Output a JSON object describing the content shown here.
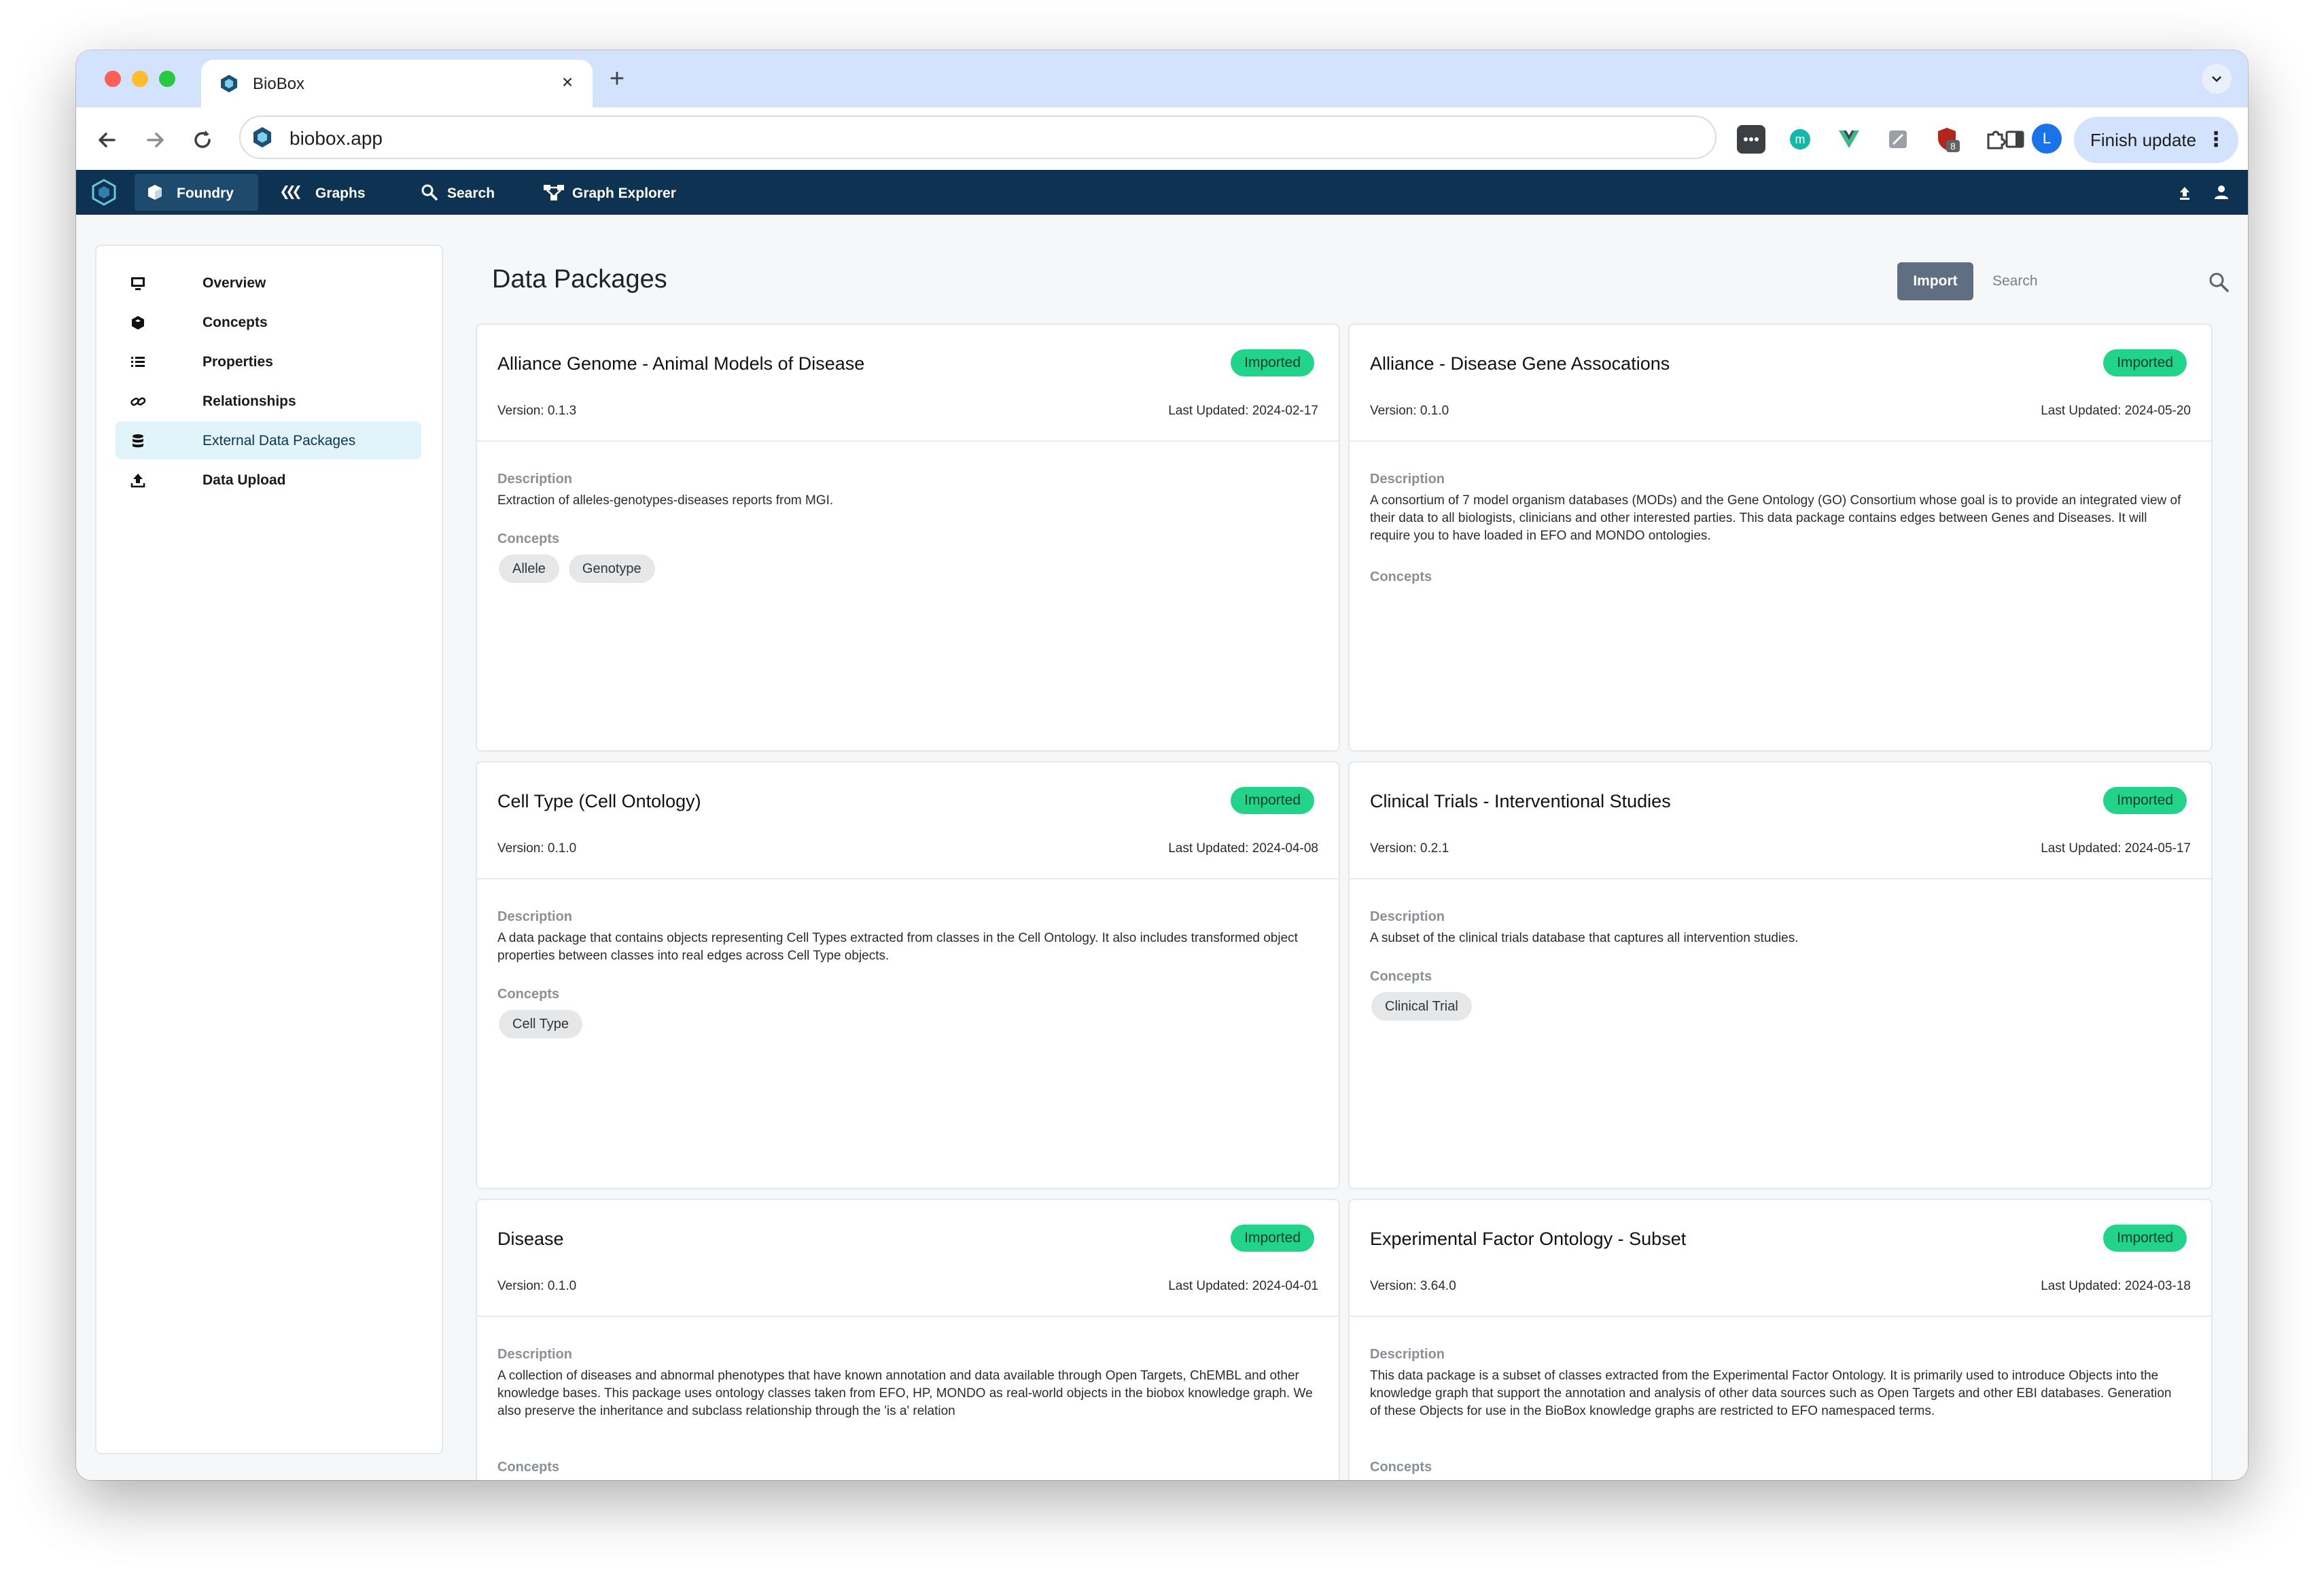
{
  "browser": {
    "tab_title": "BioBox",
    "tab_close": "×",
    "new_tab": "+",
    "url": "biobox.app",
    "profile_initial": "L",
    "extension_badge": "8",
    "finish_update": "Finish update"
  },
  "nav": {
    "items": [
      {
        "label": "Foundry",
        "icon": "cube-icon"
      },
      {
        "label": "Graphs",
        "icon": "graphs-icon"
      },
      {
        "label": "Search",
        "icon": "search-icon"
      },
      {
        "label": "Graph Explorer",
        "icon": "graph-explorer-icon"
      }
    ]
  },
  "sidebar": {
    "items": [
      {
        "label": "Overview",
        "icon": "monitor-icon"
      },
      {
        "label": "Concepts",
        "icon": "cube-icon"
      },
      {
        "label": "Properties",
        "icon": "list-icon"
      },
      {
        "label": "Relationships",
        "icon": "link-icon"
      },
      {
        "label": "External Data Packages",
        "icon": "database-icon",
        "active": true
      },
      {
        "label": "Data Upload",
        "icon": "upload-icon"
      }
    ]
  },
  "main": {
    "title": "Data Packages",
    "import_label": "Import",
    "search_placeholder": "Search",
    "labels": {
      "description": "Description",
      "concepts": "Concepts"
    },
    "cards": [
      {
        "title": "Alliance Genome - Animal Models of Disease",
        "status": "Imported",
        "version": "Version: 0.1.3",
        "updated": "Last Updated: 2024-02-17",
        "description": "Extraction of alleles-genotypes-diseases reports from MGI.",
        "concepts": [
          "Allele",
          "Genotype"
        ]
      },
      {
        "title": "Alliance - Disease Gene Assocations",
        "status": "Imported",
        "version": "Version: 0.1.0",
        "updated": "Last Updated: 2024-05-20",
        "description": "A consortium of 7 model organism databases (MODs) and the Gene Ontology (GO) Consortium whose goal is to provide an integrated view of their data to all biologists, clinicians and other interested parties. This data package contains edges between Genes and Diseases. It will require you to have loaded in EFO and MONDO ontologies.",
        "concepts": []
      },
      {
        "title": "Cell Type (Cell Ontology)",
        "status": "Imported",
        "version": "Version: 0.1.0",
        "updated": "Last Updated: 2024-04-08",
        "description": "A data package that contains objects representing Cell Types extracted from classes in the Cell Ontology. It also includes transformed object properties between classes into real edges across Cell Type objects.",
        "concepts": [
          "Cell Type"
        ]
      },
      {
        "title": "Clinical Trials - Interventional Studies",
        "status": "Imported",
        "version": "Version: 0.2.1",
        "updated": "Last Updated: 2024-05-17",
        "description": "A subset of the clinical trials database that captures all intervention studies.",
        "concepts": [
          "Clinical Trial"
        ]
      },
      {
        "title": "Disease",
        "status": "Imported",
        "version": "Version: 0.1.0",
        "updated": "Last Updated: 2024-04-01",
        "description": "A collection of diseases and abnormal phenotypes that have known annotation and data available through Open Targets, ChEMBL and other knowledge bases. This package uses ontology classes taken from EFO, HP, MONDO as real-world objects in the biobox knowledge graph. We also preserve the inheritance and subclass relationship through the 'is a' relation",
        "concepts": []
      },
      {
        "title": "Experimental Factor Ontology - Subset",
        "status": "Imported",
        "version": "Version: 3.64.0",
        "updated": "Last Updated: 2024-03-18",
        "description": "This data package is a subset of classes extracted from the Experimental Factor Ontology. It is primarily used to introduce Objects into the knowledge graph that support the annotation and analysis of other data sources such as Open Targets and other EBI databases. Generation of these Objects for use in the BioBox knowledge graphs are restricted to EFO namespaced terms.",
        "concepts": []
      }
    ]
  },
  "colors": {
    "nav_bg": "#0e3352",
    "badge_green": "#22d48a",
    "tabstrip": "#d3e3fd",
    "sidebar_active": "#e0f4f9"
  }
}
